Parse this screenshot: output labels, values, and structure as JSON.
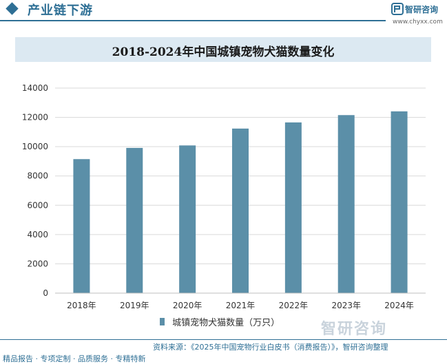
{
  "header": {
    "section_title": "产业链下游",
    "brand_name": "智研咨询",
    "brand_url": "www.chyxx.com"
  },
  "colors": {
    "bar": "#5b8fa8",
    "accent": "#2e6f95",
    "title_bg": "#dce9f2"
  },
  "chart_data": {
    "type": "bar",
    "title": "2018-2024年中国城镇宠物犬猫数量变化",
    "categories": [
      "2018年",
      "2019年",
      "2020年",
      "2021年",
      "2022年",
      "2023年",
      "2024年"
    ],
    "series": [
      {
        "name": "城镇宠物犬猫数量（万只）",
        "values": [
          9150,
          9915,
          10084,
          11235,
          11655,
          12155,
          12411
        ]
      }
    ],
    "ylim": [
      0,
      14000
    ],
    "yticks": [
      "0",
      "2000",
      "4000",
      "6000",
      "8000",
      "10000",
      "12000",
      "14000"
    ],
    "xlabel": "",
    "ylabel": "",
    "grid": true,
    "legend_position": "bottom"
  },
  "footer": {
    "source": "资料来源：《2025年中国宠物行业白皮书（消费报告）》，智研咨询整理",
    "tagline": "精品报告 · 专项定制 · 品质服务 · 专精特新",
    "brand_name": "智研咨询"
  }
}
